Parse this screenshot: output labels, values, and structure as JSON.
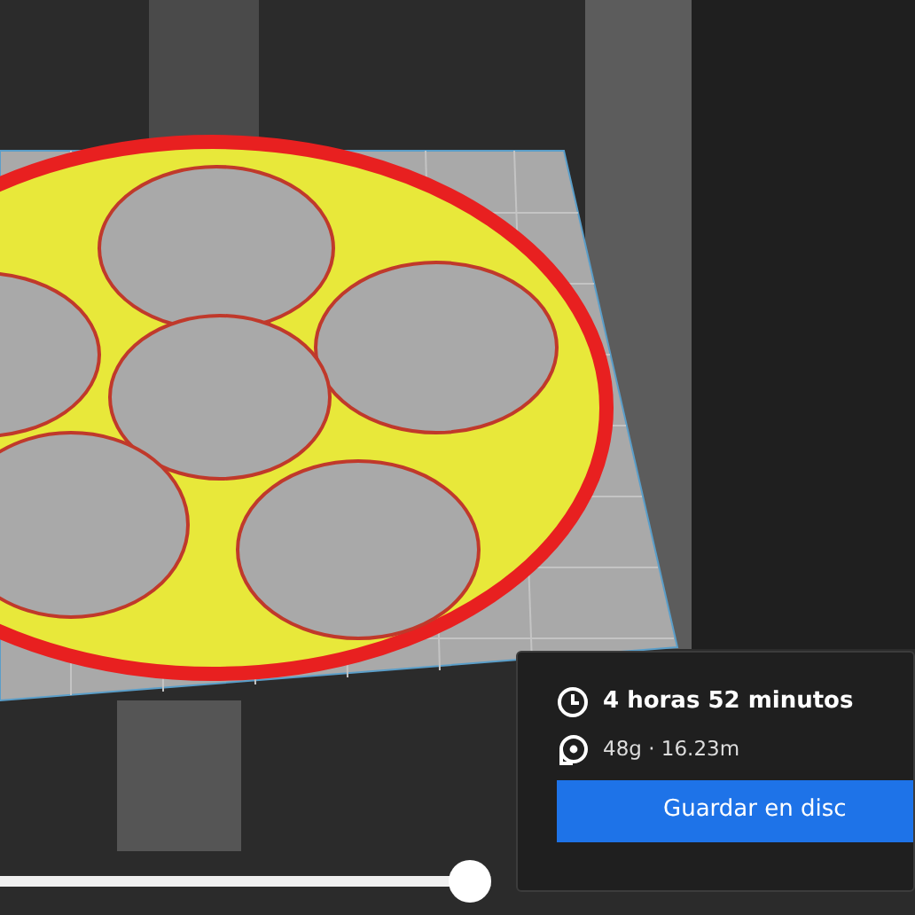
{
  "print_info": {
    "time": "4 horas 52 minutos",
    "material": "48g · 16.23m",
    "save_button": "Guardar en disc"
  },
  "layer_slider": {
    "level": 1
  }
}
